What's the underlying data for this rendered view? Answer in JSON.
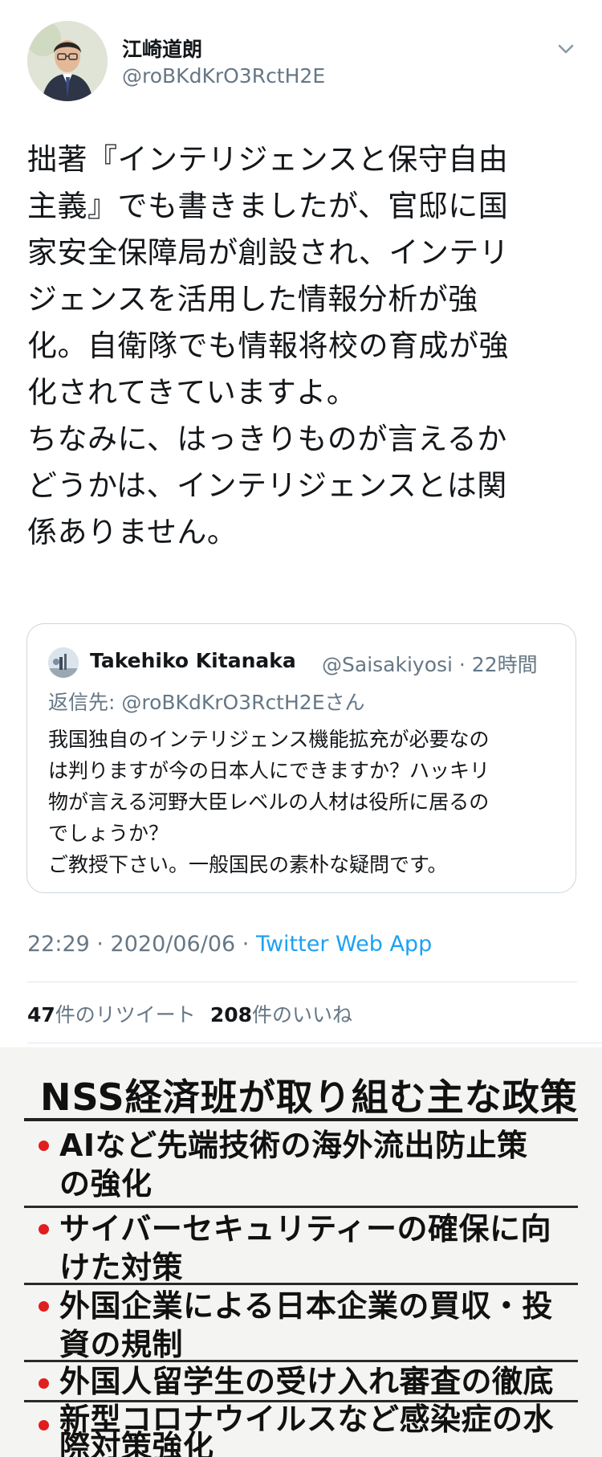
{
  "author": {
    "name": "江崎道朗",
    "handle": "@roBKdKrO3RctH2E"
  },
  "icons": {
    "avatar": "profile-photo",
    "menu": "chevron-down-icon",
    "quote_avatar": "profile-photo"
  },
  "tweet": {
    "lines": [
      "拙著『インテリジェンスと保守自由",
      "主義』でも書きましたが、官邸に国",
      "家安全保障局が創設され、インテリ",
      "ジェンスを活用した情報分析が強",
      "化。自衛隊でも情報将校の育成が強",
      "化されてきていますよ。",
      "ちなみに、はっきりものが言えるか",
      "どうかは、インテリジェンスとは関",
      "係ありません。"
    ]
  },
  "quoted": {
    "name": "Takehiko Kitanaka",
    "handle_time": "@Saisakiyosi · 22時間",
    "reply_prefix": "返信先: ",
    "reply_handle": "@roBKdKrO3RctH2Eさん",
    "lines": [
      "我国独自のインテリジェンス機能拡充が必要なの",
      "は判りますが今の日本人にできますか？ハッキリ",
      "物が言える河野大臣レベルの人材は役所に居るの",
      "でしょうか？",
      "ご教授下さい。一般国民の素朴な疑問です。"
    ]
  },
  "meta": {
    "timestamp": "22:29 · 2020/06/06 · ",
    "via": "Twitter Web App"
  },
  "stats": {
    "retweets_count": "47",
    "retweets_label": "件のリツイート",
    "likes_count": "208",
    "likes_label": "件のいいね"
  },
  "infographic": {
    "title": "NSS経済班が取り組む主な政策",
    "items": [
      {
        "lines": [
          "AIなど先端技術の海外流出防止策",
          "の強化"
        ]
      },
      {
        "lines": [
          "サイバーセキュリティーの確保に向",
          "けた対策"
        ]
      },
      {
        "lines": [
          "外国企業による日本企業の買収・投",
          "資の規制"
        ]
      },
      {
        "lines": [
          "外国人留学生の受け入れ審査の徹底"
        ]
      },
      {
        "lines": [
          "新型コロナウイルスなど感染症の水",
          "際対策強化"
        ]
      }
    ]
  },
  "colors": {
    "text": "#14171a",
    "secondary": "#657786",
    "link": "#1da1f2",
    "border": "#ccd6dd",
    "bullet": "#e01e1e"
  }
}
